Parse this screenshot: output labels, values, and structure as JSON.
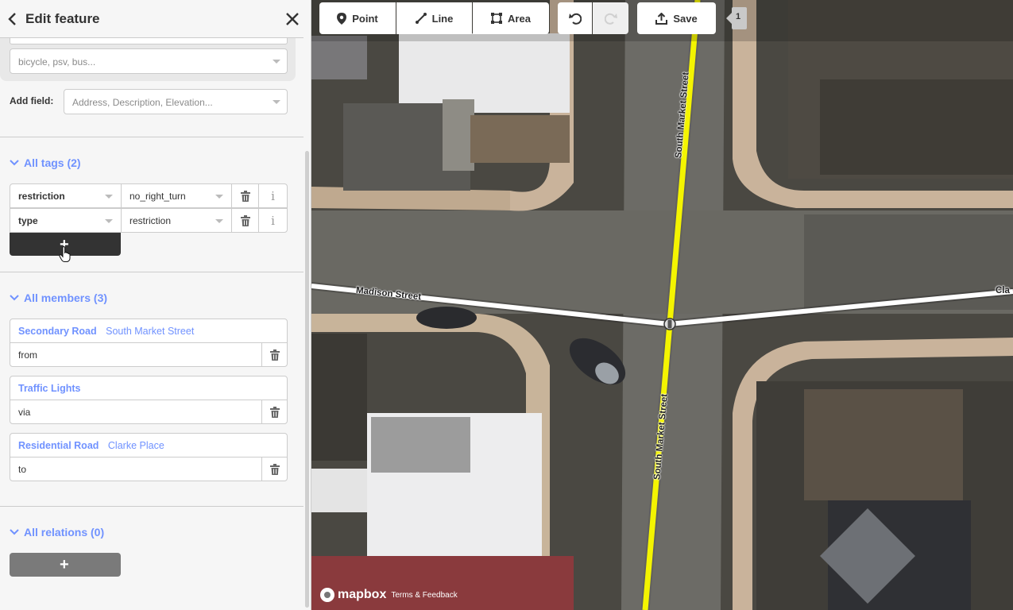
{
  "sidebar": {
    "header": {
      "title": "Edit feature"
    },
    "field_combo": {
      "placeholder": "bicycle, psv, bus..."
    },
    "add_field": {
      "label": "Add field:",
      "placeholder": "Address, Description, Elevation..."
    },
    "tags_section": {
      "title": "All tags (2)",
      "rows": [
        {
          "key": "restriction",
          "value": "no_right_turn"
        },
        {
          "key": "type",
          "value": "restriction"
        }
      ],
      "add_label": "+"
    },
    "members_section": {
      "title": "All members (3)",
      "members": [
        {
          "type": "Secondary Road",
          "name": "South Market Street",
          "role": "from"
        },
        {
          "type": "Traffic Lights",
          "name": "",
          "role": "via"
        },
        {
          "type": "Residential Road",
          "name": "Clarke Place",
          "role": "to"
        }
      ]
    },
    "relations_section": {
      "title": "All relations (0)",
      "add_label": "+"
    }
  },
  "toolbar": {
    "point_label": "Point",
    "line_label": "Line",
    "area_label": "Area",
    "save_label": "Save",
    "edit_count": "1"
  },
  "map": {
    "labels": {
      "south_market_street": "South Market Street",
      "madison_street": "Madison Street",
      "clarke_place_partial": "Cla"
    },
    "attribution": {
      "logo": "mapbox",
      "terms": "Terms & Feedback"
    },
    "colors": {
      "secondary_road": "#f4f400",
      "residential_road": "#ffffff",
      "accent": "#7092ff"
    }
  }
}
